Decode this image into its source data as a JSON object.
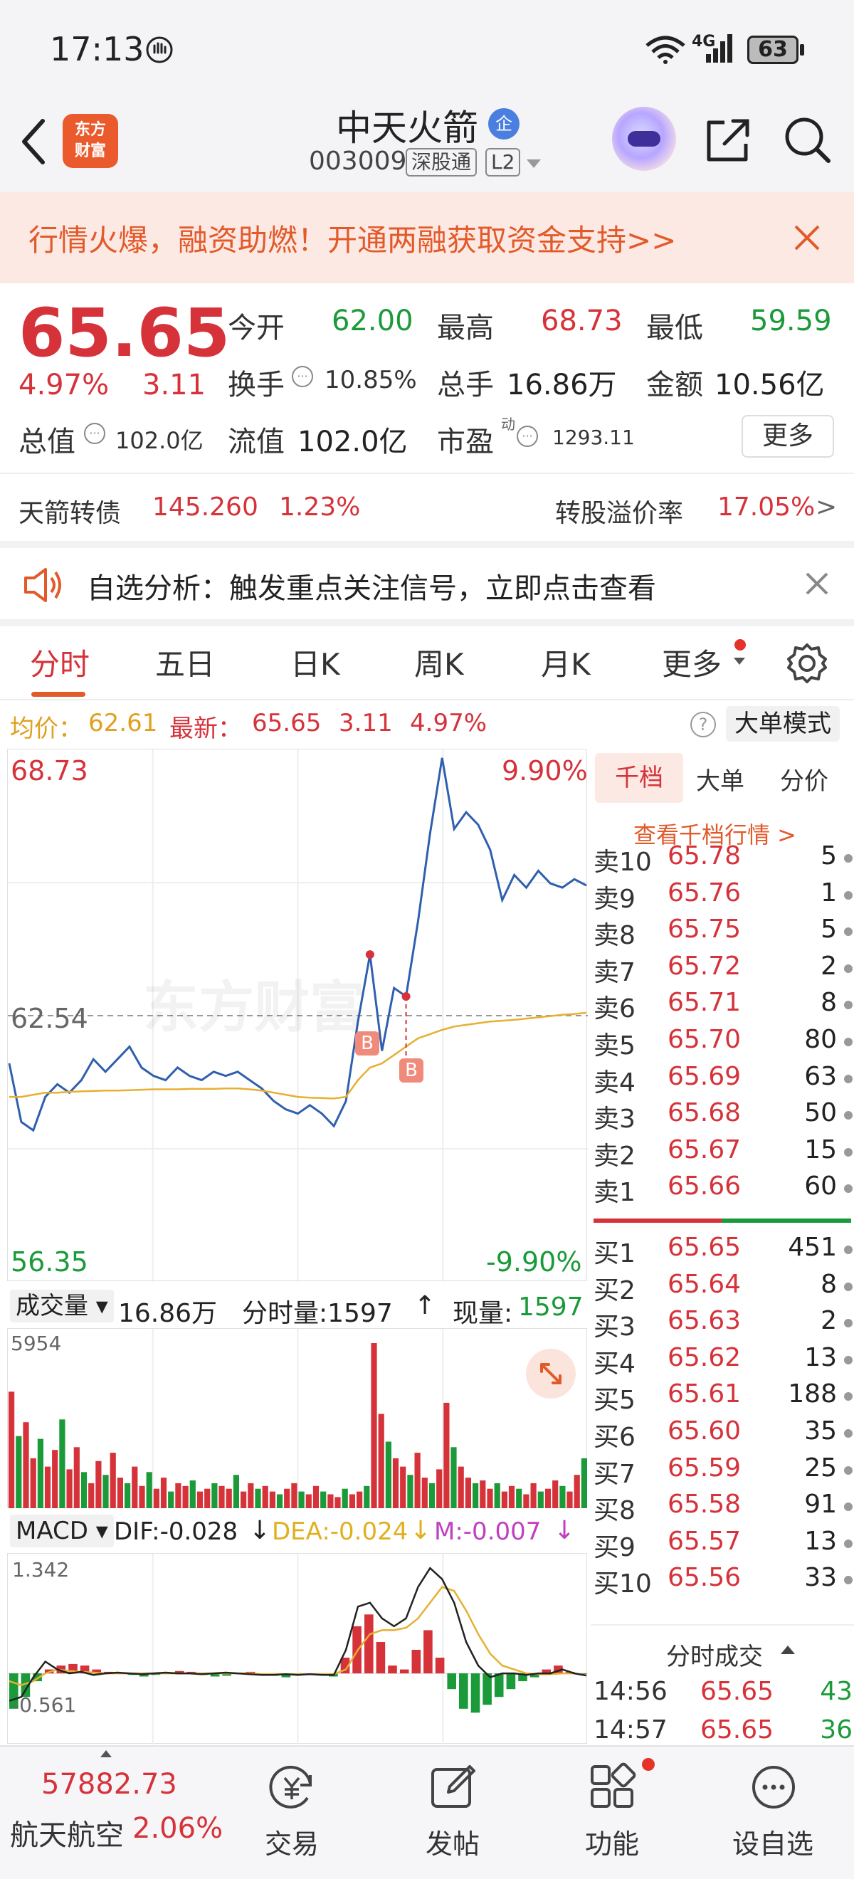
{
  "status_bar": {
    "time": "17:13",
    "network": "4G",
    "battery": "63"
  },
  "header": {
    "logo_text_line1": "东方",
    "logo_text_line2": "财富",
    "stock_name": "中天火箭",
    "enterprise_badge": "企",
    "stock_code": "003009",
    "exchange_tag": "深股通",
    "level_tag": "L2"
  },
  "promo": {
    "text": "行情火爆，融资助燃！开通两融获取资金支持>>"
  },
  "quote": {
    "price": "65.65",
    "change_pct": "4.97%",
    "change": "3.11",
    "open_label": "今开",
    "open": "62.00",
    "high_label": "最高",
    "high": "68.73",
    "low_label": "最低",
    "low": "59.59",
    "turnover_label": "换手",
    "turnover": "10.85%",
    "volume_label": "总手",
    "volume": "16.86万",
    "amount_label": "金额",
    "amount": "10.56亿",
    "mktcap_label": "总值",
    "mktcap": "102.0亿",
    "float_label": "流值",
    "float_cap": "102.0亿",
    "pe_label": "市盈",
    "pe_sup": "动",
    "pe": "1293.11",
    "more_button": "更多"
  },
  "bond": {
    "name": "天箭转债",
    "price": "145.260",
    "change_pct": "1.23%",
    "premium_label": "转股溢价率",
    "premium": "17.05%",
    "arrow": ">"
  },
  "alert": {
    "text": "自选分析：触发重点关注信号，立即点击查看"
  },
  "tabs": [
    "分时",
    "五日",
    "日K",
    "周K",
    "月K",
    "更多"
  ],
  "info_line": {
    "avg_label": "均价：",
    "avg": "62.61",
    "latest_label": "最新：",
    "latest": "65.65",
    "change": "3.11",
    "change_pct": "4.97%",
    "mode_button": "大单模式"
  },
  "chart_labels": {
    "top_price": "68.73",
    "top_pct": "9.90%",
    "mid_price": "62.54",
    "bottom_price": "56.35",
    "bottom_pct": "-9.90%",
    "watermark": "东方财富",
    "buy_marker": "B"
  },
  "chart_data": {
    "type": "line",
    "x_range": [
      "09:30",
      "15:00"
    ],
    "ylim": [
      56.35,
      68.73
    ],
    "prev_close": 62.54,
    "series": [
      {
        "values": [
          61.4,
          60.0,
          59.8,
          60.6,
          60.9,
          60.7,
          61.0,
          61.5,
          61.2,
          61.5,
          61.8,
          61.3,
          61.1,
          61.0,
          61.3,
          61.1,
          61.0,
          61.2,
          61.1,
          61.2,
          61.0,
          60.8,
          60.5,
          60.3,
          60.2,
          60.4,
          60.2,
          59.9,
          60.5,
          62.4,
          64.0,
          61.7,
          63.2,
          63.0,
          64.8,
          66.9,
          68.7,
          67.0,
          67.4,
          67.1,
          66.5,
          65.3,
          65.9,
          65.6,
          66.0,
          65.7,
          65.6,
          65.8,
          65.65
        ]
      },
      {
        "values": [
          60.6,
          60.6,
          60.65,
          60.7,
          60.7,
          60.72,
          60.73,
          60.74,
          60.75,
          60.75,
          60.76,
          60.77,
          60.78,
          60.78,
          60.78,
          60.79,
          60.79,
          60.79,
          60.8,
          60.8,
          60.78,
          60.75,
          60.7,
          60.65,
          60.6,
          60.58,
          60.57,
          60.56,
          60.6,
          61.0,
          61.3,
          61.4,
          61.6,
          61.8,
          62.0,
          62.1,
          62.2,
          62.28,
          62.32,
          62.36,
          62.4,
          62.42,
          62.44,
          62.47,
          62.5,
          62.53,
          62.56,
          62.58,
          62.61
        ]
      }
    ]
  },
  "volume": {
    "label": "成交量",
    "total": "16.86万",
    "tick_label": "分时量:1597",
    "now_label": "现量:",
    "now": "1597",
    "ymax": "5954"
  },
  "volume_data": {
    "type": "bar",
    "ylim": [
      0,
      5954
    ],
    "values": [
      4200,
      2600,
      3100,
      1800,
      2500,
      1500,
      2100,
      3200,
      1400,
      2200,
      1300,
      900,
      1700,
      1200,
      2000,
      1100,
      900,
      1500,
      800,
      1300,
      700,
      1100,
      600,
      900,
      800,
      1000,
      600,
      700,
      900,
      800,
      700,
      1200,
      600,
      900,
      700,
      800,
      600,
      500,
      700,
      900,
      600,
      500,
      800,
      600,
      500,
      400,
      700,
      500,
      600,
      800,
      5954,
      3400,
      2400,
      1800,
      1500,
      1200,
      2000,
      1100,
      900,
      1400,
      3800,
      2200,
      1500,
      1100,
      900,
      1000,
      700,
      900,
      600,
      800,
      700,
      500,
      900,
      600,
      700,
      1000,
      800,
      600,
      1200,
      1800
    ]
  },
  "macd": {
    "label": "MACD",
    "dif": "DIF:-0.028",
    "dea": "DEA:-0.024",
    "m": "M:-0.007",
    "top": "1.342",
    "bottom": "-0.561",
    "time_start": "09:30",
    "time_end": "15:00"
  },
  "macd_data": {
    "type": "bar",
    "ylim": [
      -0.561,
      1.342
    ],
    "bars": [
      -0.45,
      -0.3,
      -0.1,
      0.05,
      0.1,
      0.12,
      0.1,
      0.05,
      0.02,
      0.0,
      -0.02,
      -0.04,
      -0.02,
      0.0,
      0.03,
      0.02,
      -0.02,
      -0.04,
      -0.03,
      0.01,
      0.02,
      -0.01,
      -0.03,
      -0.05,
      -0.02,
      0.0,
      -0.02,
      -0.04,
      0.2,
      0.6,
      0.75,
      0.4,
      0.1,
      0.05,
      0.3,
      0.55,
      0.2,
      -0.2,
      -0.45,
      -0.5,
      -0.4,
      -0.3,
      -0.2,
      -0.1,
      -0.05,
      0.05,
      0.1,
      0.02,
      -0.01
    ],
    "dif": [
      -0.35,
      -0.3,
      -0.05,
      0.15,
      0.05,
      0.0,
      0.02,
      -0.02,
      0.0,
      0.01,
      0.0,
      -0.01,
      0.0,
      0.01,
      0.0,
      0.0,
      -0.01,
      0.0,
      0.01,
      0.0,
      -0.01,
      -0.02,
      -0.02,
      -0.01,
      -0.02,
      -0.01,
      -0.02,
      -0.02,
      0.3,
      0.85,
      0.9,
      0.7,
      0.6,
      0.7,
      1.1,
      1.34,
      1.2,
      0.9,
      0.4,
      0.1,
      -0.05,
      0.0,
      0.0,
      -0.02,
      0.0,
      0.0,
      0.05,
      0.0,
      -0.028
    ],
    "dea": [
      -0.1,
      -0.15,
      -0.1,
      0.0,
      0.05,
      0.03,
      0.02,
      0.01,
      0.0,
      0.0,
      0.0,
      0.0,
      0.0,
      0.0,
      0.0,
      0.0,
      0.0,
      0.0,
      0.0,
      0.0,
      0.0,
      -0.01,
      -0.01,
      -0.01,
      -0.01,
      -0.01,
      -0.01,
      -0.01,
      0.05,
      0.3,
      0.5,
      0.55,
      0.55,
      0.58,
      0.7,
      0.9,
      1.1,
      1.05,
      0.8,
      0.5,
      0.25,
      0.1,
      0.05,
      0.0,
      -0.01,
      -0.01,
      0.0,
      0.0,
      -0.024
    ]
  },
  "order_book": {
    "tabs": [
      "千档",
      "大单",
      "分价"
    ],
    "view_link": "查看千档行情 >",
    "asks": [
      {
        "label": "卖10",
        "price": "65.78",
        "vol": "5"
      },
      {
        "label": "卖9",
        "price": "65.76",
        "vol": "1"
      },
      {
        "label": "卖8",
        "price": "65.75",
        "vol": "5"
      },
      {
        "label": "卖7",
        "price": "65.72",
        "vol": "2"
      },
      {
        "label": "卖6",
        "price": "65.71",
        "vol": "8"
      },
      {
        "label": "卖5",
        "price": "65.70",
        "vol": "80"
      },
      {
        "label": "卖4",
        "price": "65.69",
        "vol": "63"
      },
      {
        "label": "卖3",
        "price": "65.68",
        "vol": "50"
      },
      {
        "label": "卖2",
        "price": "65.67",
        "vol": "15"
      },
      {
        "label": "卖1",
        "price": "65.66",
        "vol": "60"
      }
    ],
    "bids": [
      {
        "label": "买1",
        "price": "65.65",
        "vol": "451"
      },
      {
        "label": "买2",
        "price": "65.64",
        "vol": "8"
      },
      {
        "label": "买3",
        "price": "65.63",
        "vol": "2"
      },
      {
        "label": "买4",
        "price": "65.62",
        "vol": "13"
      },
      {
        "label": "买5",
        "price": "65.61",
        "vol": "188"
      },
      {
        "label": "买6",
        "price": "65.60",
        "vol": "35"
      },
      {
        "label": "买7",
        "price": "65.59",
        "vol": "25"
      },
      {
        "label": "买8",
        "price": "65.58",
        "vol": "91"
      },
      {
        "label": "买9",
        "price": "65.57",
        "vol": "13"
      },
      {
        "label": "买10",
        "price": "65.56",
        "vol": "33"
      }
    ],
    "ticks_title": "分时成交",
    "ticks": [
      {
        "time": "14:56",
        "price": "65.65",
        "vol": "43"
      },
      {
        "time": "14:57",
        "price": "65.65",
        "vol": "36"
      }
    ]
  },
  "bottom_nav": {
    "index_value": "57882.73",
    "index_name": "航天航空",
    "index_change": "2.06%",
    "items": [
      "交易",
      "发帖",
      "功能",
      "设自选"
    ]
  }
}
